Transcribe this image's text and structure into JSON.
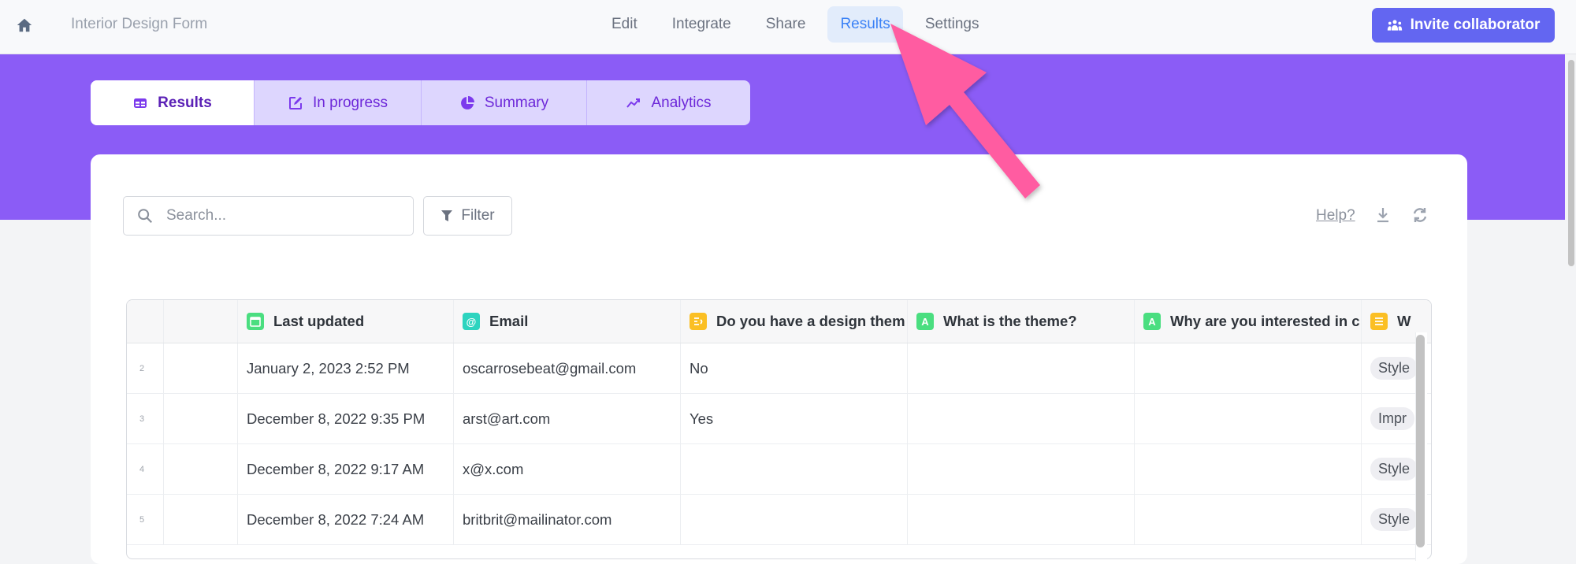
{
  "topbar": {
    "home_icon": "home-icon",
    "form_title": "Interior Design Form",
    "nav": [
      {
        "label": "Edit",
        "active": false
      },
      {
        "label": "Integrate",
        "active": false
      },
      {
        "label": "Share",
        "active": false
      },
      {
        "label": "Results",
        "active": true
      },
      {
        "label": "Settings",
        "active": false
      }
    ],
    "invite_button": {
      "label": "Invite collaborator",
      "icon": "users-icon"
    }
  },
  "colors": {
    "banner": "#8b5cf6",
    "invite_button": "#6366f1",
    "active_nav_text": "#3b82f6",
    "active_nav_bg": "#e2ecfb",
    "annotation_arrow": "#ff5ca1"
  },
  "subtabs": [
    {
      "label": "Results",
      "icon": "table-icon",
      "active": true
    },
    {
      "label": "In progress",
      "icon": "edit-icon",
      "active": false
    },
    {
      "label": "Summary",
      "icon": "pie-chart-icon",
      "active": false
    },
    {
      "label": "Analytics",
      "icon": "trend-up-icon",
      "active": false
    }
  ],
  "toolbar": {
    "search_placeholder": "Search...",
    "search_value": "",
    "filter_label": "Filter",
    "help_label": "Help?",
    "download_icon": "download-icon",
    "refresh_icon": "refresh-icon"
  },
  "table": {
    "columns": [
      {
        "label": "",
        "icon": null
      },
      {
        "label": "",
        "icon": null
      },
      {
        "label": "Last updated",
        "icon": "calendar-icon",
        "icon_color": "#4ade80"
      },
      {
        "label": "Email",
        "icon": "at-icon",
        "icon_color": "#2dd4bf"
      },
      {
        "label": "Do you have a design theme?",
        "display": "Do you have a design them",
        "icon": "yes-no-icon",
        "icon_color": "#fbbf24"
      },
      {
        "label": "What is the theme?",
        "icon": "short-text-icon",
        "icon_color": "#4ade80"
      },
      {
        "label": "Why are you interested in ...",
        "display": "Why are you interested in c",
        "icon": "long-text-icon",
        "icon_color": "#4ade80"
      },
      {
        "label": "W",
        "icon": "list-icon",
        "icon_color": "#fbbf24"
      }
    ],
    "rows": [
      {
        "num": "2",
        "last_updated": "January 2, 2023 2:52 PM",
        "email": "oscarrosebeat@gmail.com",
        "design_theme": "No",
        "theme": "",
        "why": "",
        "tag": "Style"
      },
      {
        "num": "3",
        "last_updated": "December 8, 2022 9:35 PM",
        "email": "arst@art.com",
        "design_theme": "Yes",
        "theme": "",
        "why": "",
        "tag": "Impr"
      },
      {
        "num": "4",
        "last_updated": "December 8, 2022 9:17 AM",
        "email": "x@x.com",
        "design_theme": "",
        "theme": "",
        "why": "",
        "tag": "Style"
      },
      {
        "num": "5",
        "last_updated": "December 8, 2022 7:24 AM",
        "email": "britbrit@mailinator.com",
        "design_theme": "",
        "theme": "",
        "why": "",
        "tag": "Style"
      }
    ]
  }
}
